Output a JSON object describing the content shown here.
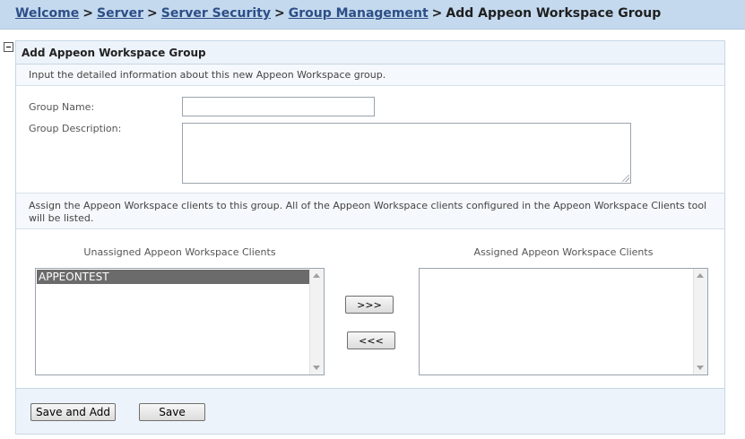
{
  "breadcrumb": {
    "links": [
      "Welcome",
      "Server",
      "Server Security",
      "Group Management"
    ],
    "separator": ">",
    "current": "Add Appeon Workspace Group"
  },
  "panel": {
    "title": "Add Appeon Workspace Group",
    "intro": "Input the detailed information about this new Appeon Workspace group."
  },
  "form": {
    "group_name_label": "Group Name:",
    "group_name_value": "",
    "group_description_label": "Group Description:",
    "group_description_value": ""
  },
  "assign": {
    "instructions": "Assign the Appeon Workspace clients to this group. All of the Appeon Workspace clients configured in the Appeon Workspace Clients tool will be listed.",
    "unassigned_header": "Unassigned Appeon Workspace Clients",
    "assigned_header": "Assigned Appeon Workspace Clients",
    "unassigned_items": [
      "APPEONTEST"
    ],
    "assigned_items": [],
    "move_right_label": ">>>",
    "move_left_label": "<<<"
  },
  "actions": {
    "save_and_add_label": "Save and Add",
    "save_label": "Save"
  },
  "colors": {
    "breadcrumb_bar": "#c4d9ee",
    "link": "#2d4f87",
    "panel_header": "#edf3fa",
    "selected_item": "#6b6b6b"
  }
}
